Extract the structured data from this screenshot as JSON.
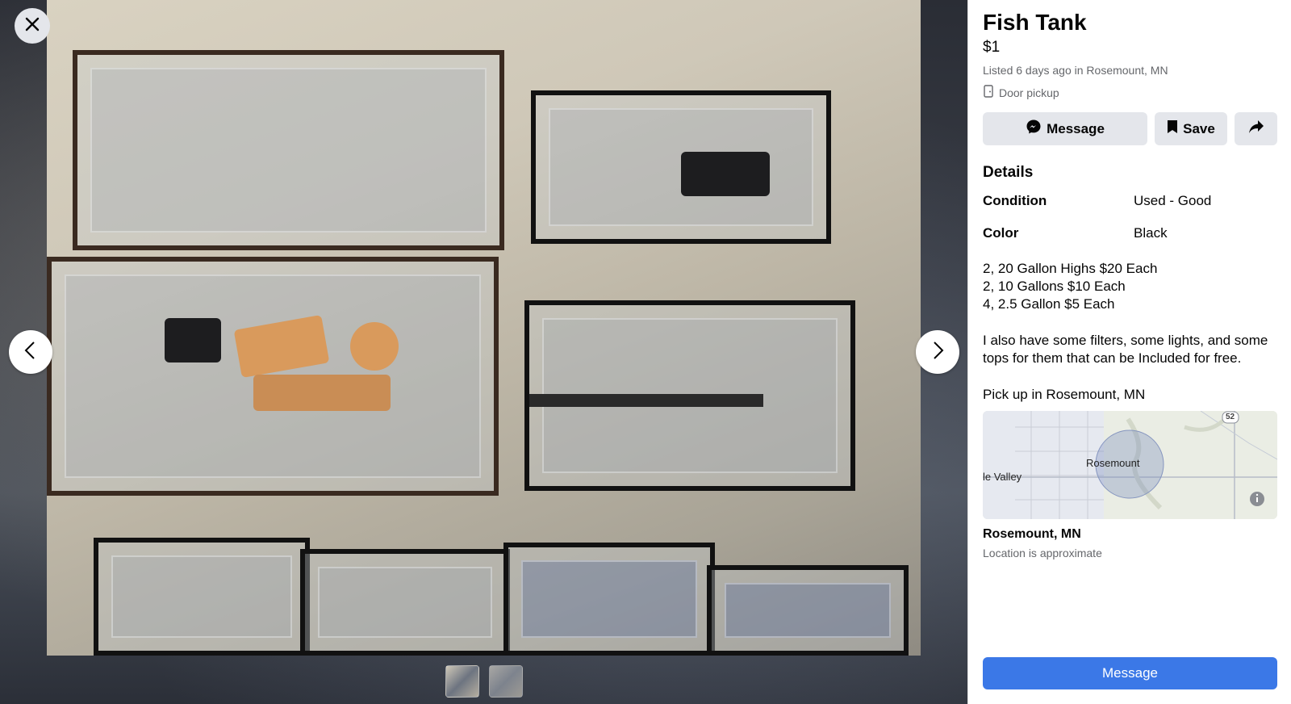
{
  "listing": {
    "title": "Fish Tank",
    "price": "$1",
    "listed": "Listed 6 days ago in Rosemount, MN",
    "pickup": "Door pickup"
  },
  "actions": {
    "message_label": "Message",
    "save_label": "Save"
  },
  "details": {
    "heading": "Details",
    "rows": [
      {
        "key": "Condition",
        "value": "Used - Good"
      },
      {
        "key": "Color",
        "value": "Black"
      }
    ],
    "description_lines": [
      "2, 20 Gallon Highs $20 Each",
      "2, 10 Gallons $10 Each",
      "4, 2.5 Gallon $5 Each"
    ],
    "extra": "I also have some filters, some lights, and some tops for them that can be Included for free.",
    "pickup_location": "Pick up in Rosemount, MN"
  },
  "map": {
    "center_label": "Rosemount",
    "west_label": "le Valley",
    "road_label": "52"
  },
  "location": {
    "name": "Rosemount, MN",
    "note": "Location is approximate"
  },
  "bottom": {
    "message_label": "Message"
  },
  "icons": {
    "close": "close-icon",
    "prev": "chevron-left-icon",
    "next": "chevron-right-icon",
    "messenger": "messenger-icon",
    "bookmark": "bookmark-icon",
    "share": "share-icon",
    "door": "door-icon",
    "info": "info-icon"
  },
  "colors": {
    "primary_button": "#3b78e7",
    "secondary_button": "#e4e6eb",
    "muted_text": "#65676b"
  }
}
